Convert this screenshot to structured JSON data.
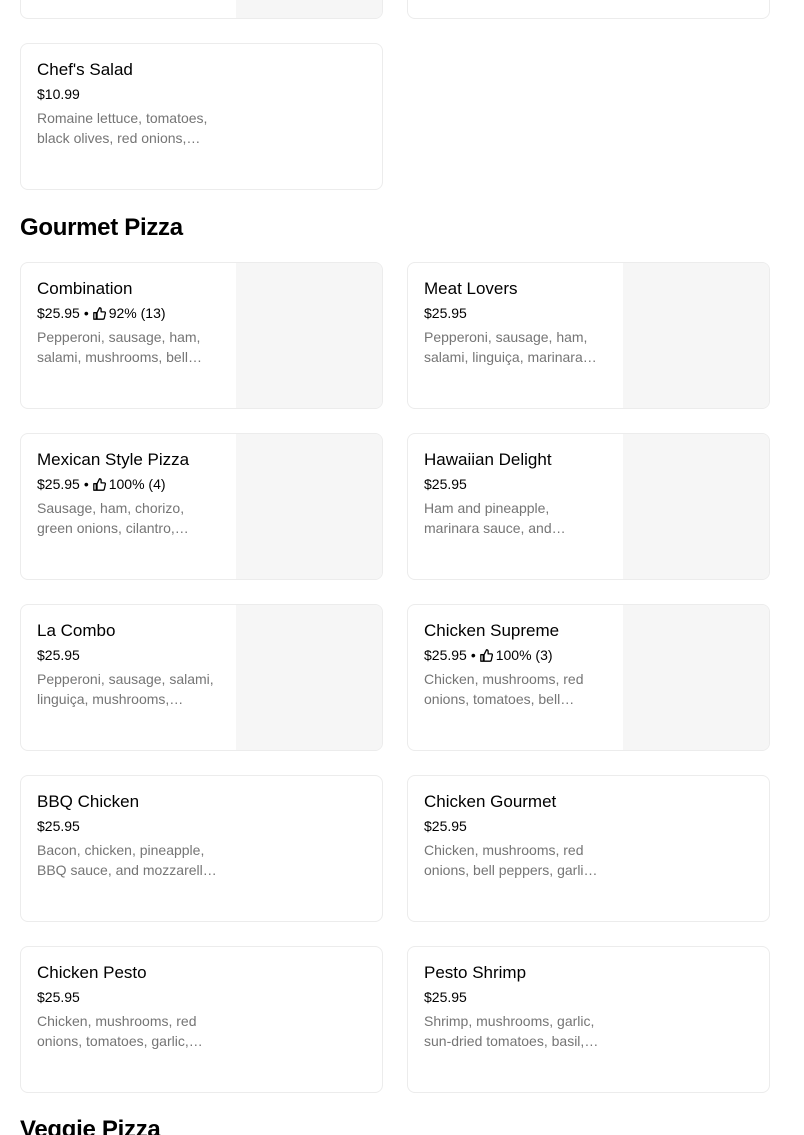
{
  "sections": [
    {
      "title": "Gourmet Pizza"
    },
    {
      "title": "Veggie Pizza"
    }
  ],
  "items": {
    "chefs_salad": {
      "name": "Chef's Salad",
      "price": "$10.99",
      "desc": "Romaine lettuce, tomatoes, black olives, red onions, cucumbers..."
    },
    "combination": {
      "name": "Combination",
      "price": "$25.95",
      "rating": "92% (13)",
      "desc": "Pepperoni, sausage, ham, salami, mushrooms, bell peppers..."
    },
    "meat_lovers": {
      "name": "Meat Lovers",
      "price": "$25.95",
      "desc": "Pepperoni, sausage, ham, salami, linguiça, marinara sauce..."
    },
    "mexican": {
      "name": "Mexican Style Pizza",
      "price": "$25.95",
      "rating": "100% (4)",
      "desc": "Sausage, ham, chorizo, green onions, cilantro, jalapeños..."
    },
    "hawaiian": {
      "name": "Hawaiian Delight",
      "price": "$25.95",
      "desc": "Ham and pineapple, marinara sauce, and mozzarella..."
    },
    "la_combo": {
      "name": "La Combo",
      "price": "$25.95",
      "desc": "Pepperoni, sausage, salami, linguiça, mushrooms, garlic..."
    },
    "chicken_supreme": {
      "name": "Chicken Supreme",
      "price": "$25.95",
      "rating": "100% (3)",
      "desc": "Chicken, mushrooms, red onions, tomatoes, bell peppers..."
    },
    "bbq_chicken": {
      "name": "BBQ Chicken",
      "price": "$25.95",
      "desc": "Bacon, chicken, pineapple, BBQ sauce, and mozzarella cheese..."
    },
    "chicken_gourmet": {
      "name": "Chicken Gourmet",
      "price": "$25.95",
      "desc": "Chicken, mushrooms, red onions, bell peppers, garlic, tomatoes..."
    },
    "chicken_pesto": {
      "name": "Chicken Pesto",
      "price": "$25.95",
      "desc": "Chicken, mushrooms, red onions, tomatoes, garlic, pesto..."
    },
    "pesto_shrimp": {
      "name": "Pesto Shrimp",
      "price": "$25.95",
      "desc": "Shrimp, mushrooms, garlic, sun-dried tomatoes, basil, pesto..."
    }
  },
  "icons": {
    "rating": "thumbs-up-icon"
  },
  "colors": {
    "text": "#000000",
    "muted": "#757575",
    "border": "#ececec",
    "thumb_bg": "#f6f6f6"
  }
}
